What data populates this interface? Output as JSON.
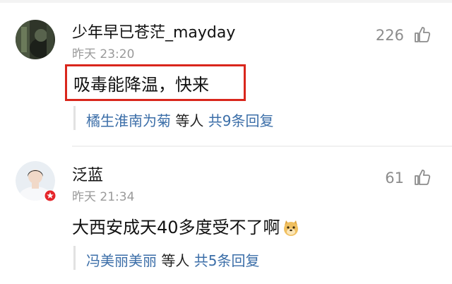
{
  "comments": [
    {
      "username": "少年早已苍茫_mayday",
      "timestamp": "昨天 23:20",
      "likes": "226",
      "text": "吸毒能降温，快来",
      "highlighted": true,
      "replies": {
        "names": "橘生淮南为菊",
        "etc": " 等人 ",
        "total": "共9条回复"
      }
    },
    {
      "username": "泛蓝",
      "timestamp": "昨天 21:34",
      "likes": "61",
      "text": "大西安成天40多度受不了啊",
      "emoji": "doge-emoji",
      "badge": "verified-badge",
      "replies": {
        "names": "冯美丽美丽",
        "etc": " 等人 ",
        "total": "共5条回复"
      }
    }
  ],
  "colors": {
    "highlight_border": "#d9261c",
    "link_blue": "#3b6ea8",
    "badge_red": "#e5252a",
    "secondary_text": "#9a9a9a"
  },
  "icons": [
    "thumbs-up-icon",
    "star-icon",
    "doge-emoji"
  ]
}
